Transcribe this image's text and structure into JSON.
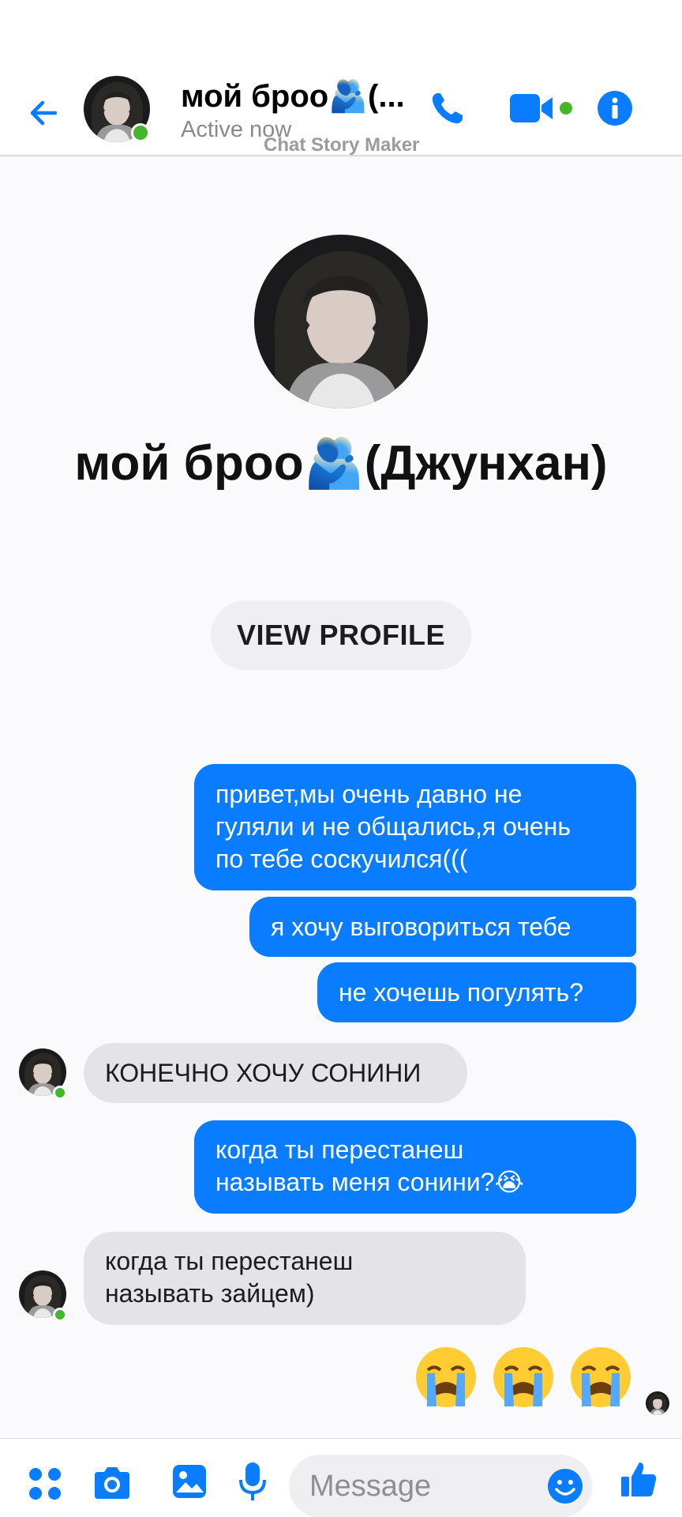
{
  "header": {
    "contact_name": "мой броо🫂(...",
    "status": "Active now",
    "watermark": "Chat Story Maker"
  },
  "profile": {
    "name": "мой броо🫂(Джунхан)",
    "view_profile_label": "VIEW PROFILE"
  },
  "messages": [
    {
      "side": "out",
      "text": "привет,мы очень давно не\nгуляли и не общались,я очень\nпо тебе соскучился((("
    },
    {
      "side": "out",
      "text": "я хочу выговориться тебе"
    },
    {
      "side": "out",
      "text": "не хочешь погулять?"
    },
    {
      "side": "in",
      "text": "КОНЕЧНО ХОЧУ СОНИНИ"
    },
    {
      "side": "out",
      "text": "когда ты перестанеш\nназывать меня сонини?😭"
    },
    {
      "side": "in",
      "text": "когда ты перестанеш\nназывать зайцем)"
    },
    {
      "side": "out",
      "text": "😭😭😭"
    }
  ],
  "composer": {
    "placeholder": "Message"
  },
  "colors": {
    "accent": "#0a7cff",
    "online": "#42b72a",
    "incoming_bubble": "#e4e4e7"
  },
  "icons": [
    "back-arrow-icon",
    "phone-icon",
    "video-camera-icon",
    "info-icon",
    "apps-icon",
    "camera-icon",
    "gallery-icon",
    "microphone-icon",
    "emoji-icon",
    "thumbs-up-icon"
  ]
}
